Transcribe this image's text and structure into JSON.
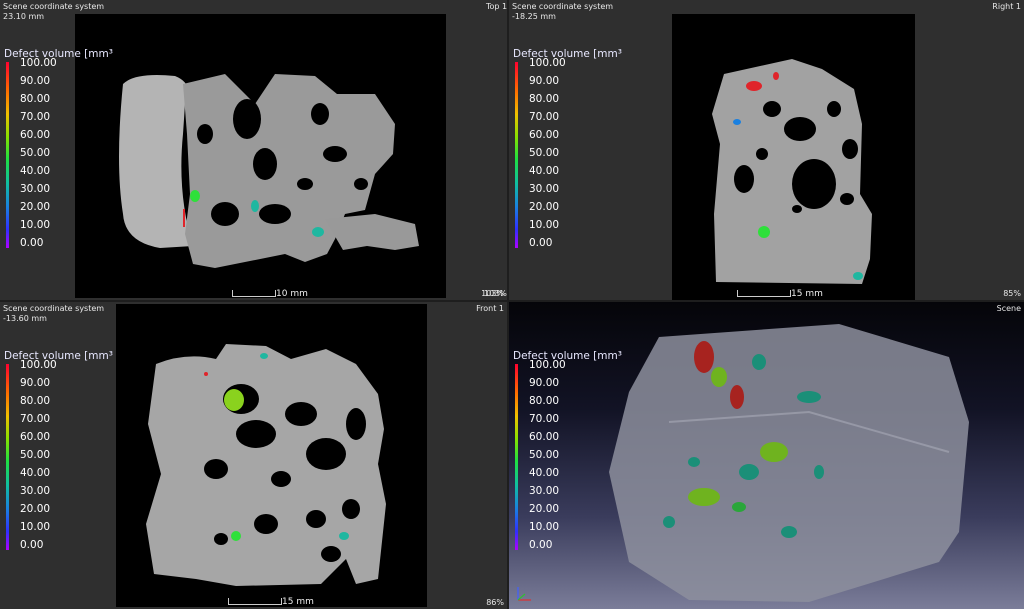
{
  "views": {
    "top": {
      "coord_system": "Scene coordinate system",
      "position": "23.10 mm",
      "name": "Top 1",
      "zoom": "103%",
      "scale": "10 mm"
    },
    "right": {
      "coord_system": "Scene coordinate system",
      "position": "-18.25 mm",
      "name": "Right 1",
      "zoom": "85%",
      "scale": "15 mm"
    },
    "front": {
      "coord_system": "Scene coordinate system",
      "position": "-13.60 mm",
      "name": "Front 1",
      "zoom": "86%",
      "scale": "15 mm"
    },
    "scene": {
      "name": "Scene"
    }
  },
  "legend": {
    "title": "Defect volume [mm³",
    "ticks": [
      "100.00",
      "90.00",
      "80.00",
      "70.00",
      "60.00",
      "50.00",
      "40.00",
      "30.00",
      "20.00",
      "10.00",
      "0.00"
    ]
  },
  "icons": {
    "axis": "axis-triad-icon"
  },
  "colors": {
    "defect_red": "#e0242a",
    "defect_green": "#2ee03a",
    "defect_teal": "#1fb7a0",
    "defect_lime": "#8ad21e"
  }
}
